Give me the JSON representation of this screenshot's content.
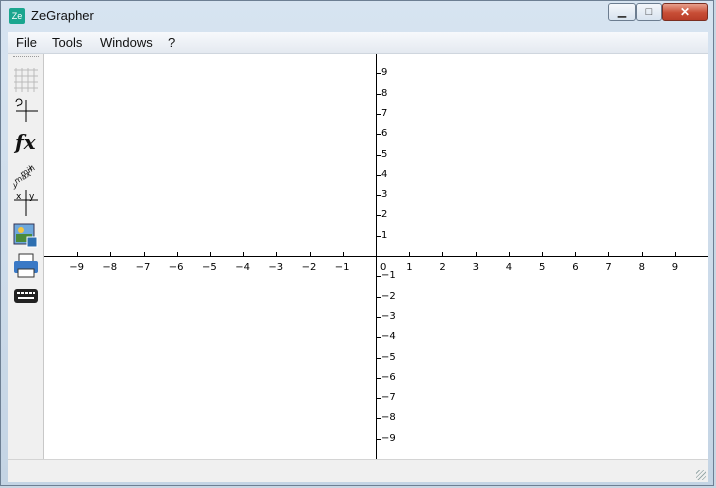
{
  "window": {
    "title": "ZeGrapher",
    "app_icon_text": "Ze"
  },
  "menu": [
    "File",
    "Tools",
    "Windows",
    "?"
  ],
  "toolbar": {
    "items": [
      "grid-icon",
      "axis-settings-icon",
      "fx-icon",
      "range-icon",
      "table-icon",
      "export-image-icon",
      "print-icon",
      "keyboard-icon"
    ],
    "fx_label": "fx"
  },
  "graph": {
    "x_labels": [
      "-9",
      "-8",
      "-7",
      "-6",
      "-5",
      "-4",
      "-3",
      "-2",
      "-1",
      "1",
      "2",
      "3",
      "4",
      "5",
      "6",
      "7",
      "8",
      "9"
    ],
    "y_labels": [
      "9",
      "8",
      "7",
      "6",
      "5",
      "4",
      "3",
      "2",
      "1",
      "-1",
      "-2",
      "-3",
      "-4",
      "-5",
      "-6",
      "-7",
      "-8",
      "-9"
    ],
    "origin_label": "0",
    "x_range": [
      -9.9,
      9.9
    ],
    "y_range": [
      -9.9,
      9.9
    ]
  }
}
